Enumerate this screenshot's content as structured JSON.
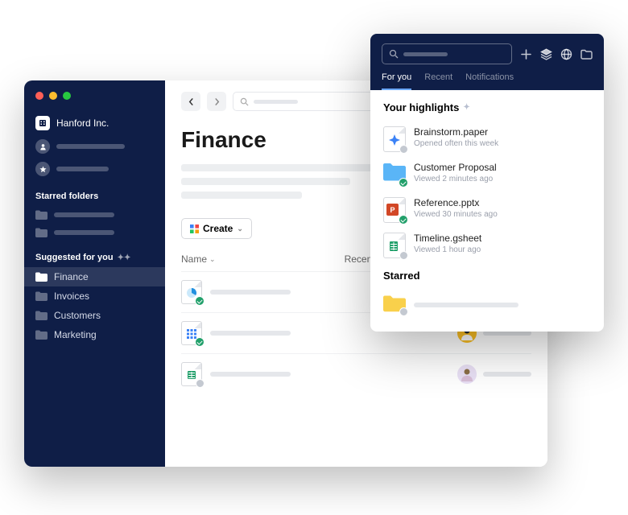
{
  "sidebar": {
    "org_name": "Hanford Inc.",
    "starred_title": "Starred folders",
    "suggested_title": "Suggested for you",
    "folders": [
      {
        "label": "Finance"
      },
      {
        "label": "Invoices"
      },
      {
        "label": "Customers"
      },
      {
        "label": "Marketing"
      }
    ]
  },
  "main": {
    "page_title": "Finance",
    "create_label": "Create",
    "col_name": "Name",
    "col_recent": "Recent"
  },
  "popover": {
    "tabs": [
      {
        "label": "For you"
      },
      {
        "label": "Recent"
      },
      {
        "label": "Notifications"
      }
    ],
    "highlights_title": "Your highlights",
    "items": [
      {
        "name": "Brainstorm.paper",
        "meta": "Opened often this week"
      },
      {
        "name": "Customer Proposal",
        "meta": "Viewed 2 minutes ago"
      },
      {
        "name": "Reference.pptx",
        "meta": "Viewed 30 minutes ago"
      },
      {
        "name": "Timeline.gsheet",
        "meta": "Viewed 1 hour ago"
      }
    ],
    "starred_title": "Starred"
  }
}
